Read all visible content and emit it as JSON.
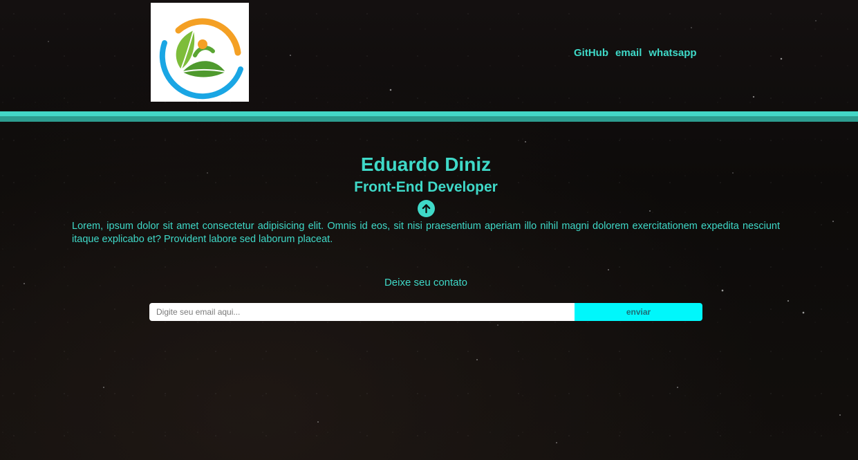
{
  "header": {
    "logo_icon": "leaf-person-logo-icon",
    "nav": {
      "github": "GitHub",
      "email": "email",
      "whatsapp": "whatsapp"
    }
  },
  "hero": {
    "name": "Eduardo Diniz",
    "role": "Front-End Developer",
    "scroll_icon": "arrow-up-circle-icon",
    "description": "Lorem, ipsum dolor sit amet consectetur adipisicing elit. Omnis id eos, sit nisi praesentium aperiam illo nihil magni dolorem exercitationem expedita nesciunt itaque explicabo et? Provident labore sed laborum placeat."
  },
  "contact": {
    "label": "Deixe seu contato",
    "email_placeholder": "Digite seu email aqui...",
    "email_value": "",
    "submit_label": "enviar"
  },
  "colors": {
    "accent": "#3fd9c8",
    "divider_light": "#43d6c6",
    "divider_dark": "#2d9d90",
    "button": "#00f7fb",
    "background": "#0d0b0a"
  }
}
